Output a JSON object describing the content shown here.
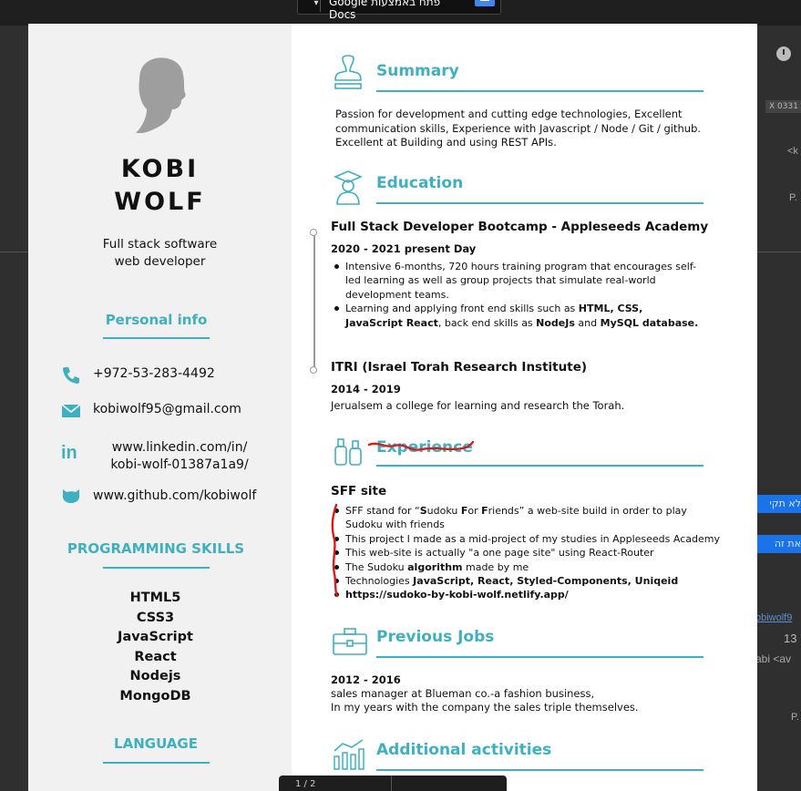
{
  "viewer": {
    "open_with_label": "פתח באמצעות Google Docs",
    "page_indicator": "1 / 2"
  },
  "background_fragments": {
    "tag_x": "X",
    "tag_text": "0331",
    "frag1": "<k",
    "frag2": "P.",
    "bar1": "לא תקי",
    "bar2": "את זה",
    "email_frag": "obiwolf9",
    "num_frag": "13",
    "sender_frag": "abi <av",
    "frag3": "P."
  },
  "profile": {
    "first_name": "KOBI",
    "last_name": "WOLF",
    "role_line1": "Full stack software",
    "role_line2": "web developer"
  },
  "personal_info": {
    "heading": "Personal info",
    "phone": "+972-53-283-4492",
    "email": "kobiwolf95@gmail.com",
    "linkedin_line1": "www.linkedin.com/in/",
    "linkedin_line2": "kobi-wolf-01387a1a9/",
    "github": "www.github.com/kobiwolf"
  },
  "skills": {
    "heading": "PROGRAMMING SKILLS",
    "items": [
      "HTML5",
      "CSS3",
      "JavaScript",
      "React",
      "Nodejs",
      "MongoDB"
    ]
  },
  "language": {
    "heading": "LANGUAGE"
  },
  "summary": {
    "title": "Summary",
    "text": "Passion for development and cutting edge technologies, Excellent communication skills, Experience with Javascript / Node / Git / github. Excellent at Building and using REST APIs."
  },
  "education": {
    "title": "Education",
    "entries": [
      {
        "title": "Full Stack Developer Bootcamp - Appleseeds Academy",
        "dates": "2020 - 2021 present Day",
        "bullet1": "Intensive 6-months, 720 hours training program that encourages self-led learning as well as group projects that simulate real-world development teams.",
        "bullet2_pre": "Learning and applying front end skills such as ",
        "bullet2_b1": "HTML, CSS, JavaScript React",
        "bullet2_mid": ", back end skills as ",
        "bullet2_b2": "NodeJs",
        "bullet2_and": " and ",
        "bullet2_b3": "MySQL database."
      },
      {
        "title": "ITRI (Israel Torah Research Institute)",
        "dates": "2014 - 2019",
        "text": "Jerualsem a college for learning and research the Torah."
      }
    ]
  },
  "experience": {
    "title": "Experience",
    "project_title": "SFF site",
    "b1_pre": "SFF stand for “",
    "b1_s": "S",
    "b1_udoku": "udoku ",
    "b1_f1": "F",
    "b1_or": "or ",
    "b1_f2": "F",
    "b1_rest": "riends” a web-site build in order to play Sudoku with friends",
    "b2": "This project I made as a mid-project of my studies in Appleseeds Academy",
    "b3": "This web-site is actually \"a one page site\" using React-Router",
    "b4_pre": "The Sudoku ",
    "b4_bold": "algorithm",
    "b4_post": " made by me",
    "b5_pre": "Technologies ",
    "b5_bold": "JavaScript, React, Styled-Components, Uniqeid",
    "b6": "https://sudoko-by-kobi-wolf.netlify.app/"
  },
  "previous_jobs": {
    "title": "Previous Jobs",
    "dates": "2012 - 2016",
    "line1": "sales manager at Blueman co.-a fashion business,",
    "line2": "In my years with the company the sales triple themselves."
  },
  "additional": {
    "title": "Additional activities"
  },
  "colors": {
    "accent": "#3fb0c0",
    "sidebar_bg": "#f1f1f1",
    "annotation_red": "#d81b1b",
    "viewer_bg": "#2f2f2f"
  }
}
